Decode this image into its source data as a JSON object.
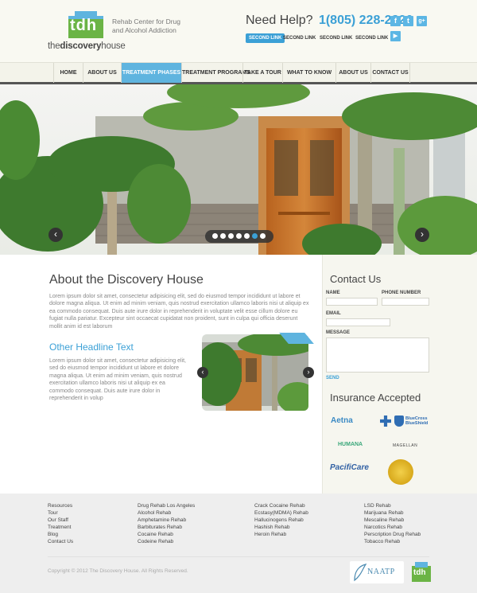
{
  "header": {
    "logo": {
      "mark": "tdh",
      "name_light": "the",
      "name_bold": "discovery",
      "name_end": "house"
    },
    "tagline": "Rehab Center for Drug and Alcohol Addiction",
    "help_label": "Need Help?",
    "phone": "1(805) 228-2826",
    "social": [
      {
        "icon": "facebook-icon",
        "glyph": "f"
      },
      {
        "icon": "twitter-icon",
        "glyph": "t"
      },
      {
        "icon": "google-plus-icon",
        "glyph": "g+"
      },
      {
        "icon": "youtube-icon",
        "glyph": "▶"
      }
    ],
    "toplinks": [
      "SECOND LINK",
      "SECOND LINK",
      "SECOND LINK",
      "SECOND LINK"
    ]
  },
  "nav": {
    "items": [
      "HOME",
      "ABOUT US",
      "TREATMENT PHASES",
      "TREATMENT PROGRAMS",
      "TAKE A TOUR",
      "WHAT TO KNOW",
      "ABOUT US",
      "CONTACT US"
    ],
    "active_index": 2
  },
  "slider": {
    "prev_glyph": "‹",
    "next_glyph": "›",
    "dot_count": 7,
    "active_dot": 5
  },
  "about": {
    "title": "About the Discovery House",
    "text": "Lorem ipsum dolor sit amet, consectetur adipisicing elit, sed do eiusmod tempor incididunt ut labore et dolore magna aliqua. Ut enim ad minim veniam, quis nostrud exercitation ullamco laboris nisi ut aliquip ex ea commodo consequat. Duis aute irure dolor in reprehenderit in voluptate velit esse cillum dolore eu fugiat nulla pariatur. Excepteur sint occaecat cupidatat non proident, sunt in culpa qui officia deserunt mollit anim id est laborum"
  },
  "other": {
    "title": "Other Headline Text",
    "text": "Lorem ipsum dolor sit amet, consectetur adipisicing elit, sed do eiusmod tempor incididunt ut labore et dolore magna aliqua. Ut enim ad minim veniam, quis nostrud exercitation ullamco laboris nisi ut aliquip ex ea commodo consequat. Duis aute irure dolor in reprehenderit in volup"
  },
  "contact": {
    "title": "Contact Us",
    "name_label": "NAME",
    "phone_label": "PHONE NUMBER",
    "email_label": "EMAIL",
    "message_label": "MESSAGE",
    "send_label": "SEND"
  },
  "insurance": {
    "title": "Insurance Accepted",
    "logos": [
      "Aetna",
      "BlueCross BlueShield",
      "HUMANA",
      "MAGELLAN",
      "PacifiCare",
      "Gold Seal"
    ]
  },
  "footer": {
    "columns": [
      [
        "Resources",
        "Tour",
        "Our Staff",
        "Treatment",
        "Blog",
        "Contact Us"
      ],
      [
        "Drug Rehab Los Angeles",
        "Alcohol Rehab",
        "Amphetamine Rehab",
        "Barbiturates Rehab",
        "Cocaine Rehab",
        "Codeine Rehab"
      ],
      [
        "Crack Cocaine Rehab",
        "Ecstasy(MDMA) Rehab",
        "Hallucinogens Rehab",
        "Hashish Rehab",
        "Heroin Rehab"
      ],
      [
        "LSD Rehab",
        "Marijuana Rehab",
        "Mescaline Rehab",
        "Narcotics Rehab",
        "Perscription Drug Rehab",
        "Tobacco Rehab"
      ]
    ],
    "copyright": "Copyright © 2012 The Discovery House. All Rights Reserved.",
    "naatp": "NAATP",
    "small_logo": "tdh"
  },
  "colors": {
    "accent": "#3ba0d6",
    "nav_active": "#5fb4df",
    "logo_green": "#6bb445",
    "text_dark": "#444444"
  }
}
